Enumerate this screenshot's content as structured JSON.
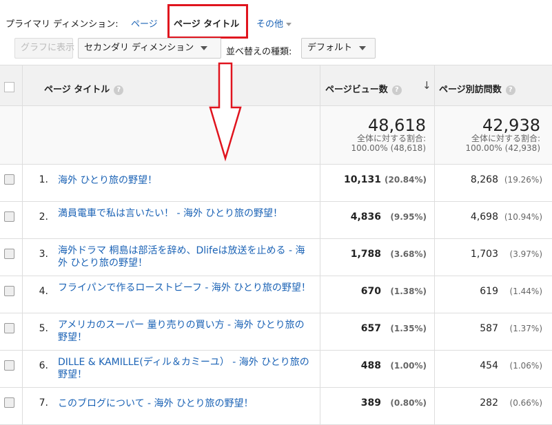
{
  "primary_dimension": {
    "label": "プライマリ ディメンション:",
    "options": {
      "page": "ページ",
      "page_title": "ページ タイトル",
      "other": "その他"
    }
  },
  "toolbar": {
    "graph_button": "グラフに表示",
    "secondary_dimension": "セカンダリ ディメンション",
    "sort_type_label": "並べ替えの種類:",
    "sort_type_value": "デフォルト"
  },
  "table": {
    "headers": {
      "title": "ページ タイトル",
      "pageviews": "ページビュー数",
      "unique": "ページ別訪問数"
    },
    "totals": {
      "pageviews": "48,618",
      "pageviews_line1": "全体に対する割合:",
      "pageviews_line2": "100.00% (48,618)",
      "unique": "42,938",
      "unique_line1": "全体に対する割合:",
      "unique_line2": "100.00% (42,938)"
    },
    "rows": [
      {
        "index": "1.",
        "title": "海外 ひとり旅の野望！",
        "pv": "10,131",
        "pv_pct": "(20.84%)",
        "uv": "8,268",
        "uv_pct": "(19.26%)"
      },
      {
        "index": "2.",
        "title": "満員電車で私は言いたい！ - 海外 ひとり旅の野望！",
        "pv": "4,836",
        "pv_pct": "(9.95%)",
        "uv": "4,698",
        "uv_pct": "(10.94%)"
      },
      {
        "index": "3.",
        "title": "海外ドラマ 桐島は部活を辞め、Dlifeは放送を止める - 海外 ひとり旅の野望！",
        "pv": "1,788",
        "pv_pct": "(3.68%)",
        "uv": "1,703",
        "uv_pct": "(3.97%)"
      },
      {
        "index": "4.",
        "title": "フライパンで作るローストビーフ - 海外 ひとり旅の野望！",
        "pv": "670",
        "pv_pct": "(1.38%)",
        "uv": "619",
        "uv_pct": "(1.44%)"
      },
      {
        "index": "5.",
        "title": "アメリカのスーパー 量り売りの買い方 - 海外 ひとり旅の野望！",
        "pv": "657",
        "pv_pct": "(1.35%)",
        "uv": "587",
        "uv_pct": "(1.37%)"
      },
      {
        "index": "6.",
        "title": "DILLE & KAMILLE(ディル＆カミーユ） - 海外 ひとり旅の野望！",
        "pv": "488",
        "pv_pct": "(1.00%)",
        "uv": "454",
        "uv_pct": "(1.06%)"
      },
      {
        "index": "7.",
        "title": "このブログについて - 海外 ひとり旅の野望！",
        "pv": "389",
        "pv_pct": "(0.80%)",
        "uv": "282",
        "uv_pct": "(0.66%)"
      }
    ]
  },
  "colors": {
    "link": "#1a62b5",
    "highlight": "#e0141e"
  }
}
